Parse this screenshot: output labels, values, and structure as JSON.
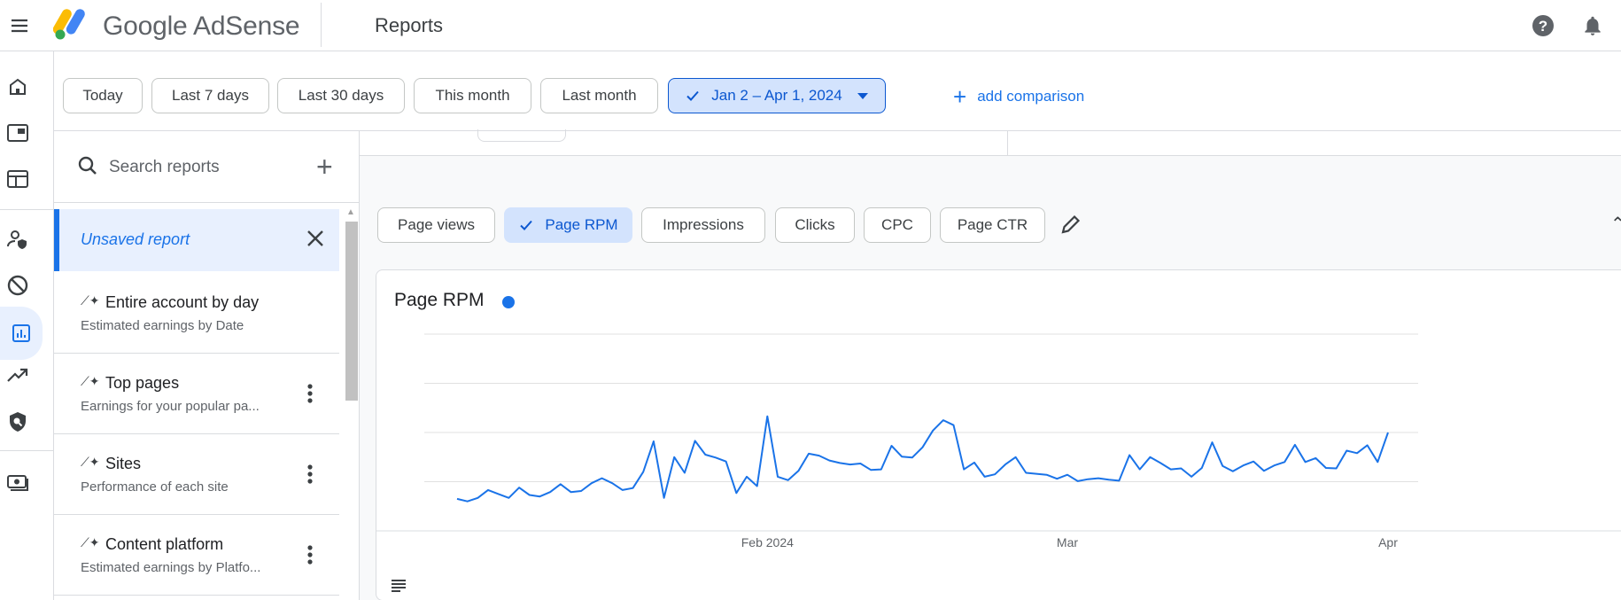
{
  "header": {
    "brand": "Google AdSense",
    "page_title": "Reports"
  },
  "date_chips": [
    {
      "label": "Today"
    },
    {
      "label": "Last 7 days"
    },
    {
      "label": "Last 30 days"
    },
    {
      "label": "This month"
    },
    {
      "label": "Last month"
    },
    {
      "label": "Jan 2 – Apr 1, 2024",
      "selected": true
    }
  ],
  "add_comparison": "add comparison",
  "reports_panel": {
    "search_placeholder": "Search reports",
    "unsaved_label": "Unsaved report",
    "items": [
      {
        "title": "Entire account by day",
        "subtitle": "Estimated earnings by Date"
      },
      {
        "title": "Top pages",
        "subtitle": "Earnings for your popular pa..."
      },
      {
        "title": "Sites",
        "subtitle": "Performance of each site"
      },
      {
        "title": "Content platform",
        "subtitle": "Estimated earnings by Platfo..."
      }
    ]
  },
  "metric_chips": [
    {
      "label": "Page views"
    },
    {
      "label": "Page RPM",
      "selected": true
    },
    {
      "label": "Impressions"
    },
    {
      "label": "Clicks"
    },
    {
      "label": "CPC"
    },
    {
      "label": "Page CTR"
    }
  ],
  "colors": {
    "accent": "#1a73e8",
    "selected_chip_bg": "#d3e3fd",
    "line": "#1a73e8"
  },
  "chart_data": {
    "type": "line",
    "title": "Page RPM",
    "xlabel": "",
    "ylabel": "",
    "x_tick_labels": [
      "Feb 2024",
      "Mar",
      "Apr"
    ],
    "grid": true,
    "gridline_count": 4,
    "ylim": [
      0,
      4
    ],
    "x": [
      "2024-01-02",
      "2024-01-03",
      "2024-01-04",
      "2024-01-05",
      "2024-01-06",
      "2024-01-07",
      "2024-01-08",
      "2024-01-09",
      "2024-01-10",
      "2024-01-11",
      "2024-01-12",
      "2024-01-13",
      "2024-01-14",
      "2024-01-15",
      "2024-01-16",
      "2024-01-17",
      "2024-01-18",
      "2024-01-19",
      "2024-01-20",
      "2024-01-21",
      "2024-01-22",
      "2024-01-23",
      "2024-01-24",
      "2024-01-25",
      "2024-01-26",
      "2024-01-27",
      "2024-01-28",
      "2024-01-29",
      "2024-01-30",
      "2024-01-31",
      "2024-02-01",
      "2024-02-02",
      "2024-02-03",
      "2024-02-04",
      "2024-02-05",
      "2024-02-06",
      "2024-02-07",
      "2024-02-08",
      "2024-02-09",
      "2024-02-10",
      "2024-02-11",
      "2024-02-12",
      "2024-02-13",
      "2024-02-14",
      "2024-02-15",
      "2024-02-16",
      "2024-02-17",
      "2024-02-18",
      "2024-02-19",
      "2024-02-20",
      "2024-02-21",
      "2024-02-22",
      "2024-02-23",
      "2024-02-24",
      "2024-02-25",
      "2024-02-26",
      "2024-02-27",
      "2024-02-28",
      "2024-02-29",
      "2024-03-01",
      "2024-03-02",
      "2024-03-03",
      "2024-03-04",
      "2024-03-05",
      "2024-03-06",
      "2024-03-07",
      "2024-03-08",
      "2024-03-09",
      "2024-03-10",
      "2024-03-11",
      "2024-03-12",
      "2024-03-13",
      "2024-03-14",
      "2024-03-15",
      "2024-03-16",
      "2024-03-17",
      "2024-03-18",
      "2024-03-19",
      "2024-03-20",
      "2024-03-21",
      "2024-03-22",
      "2024-03-23",
      "2024-03-24",
      "2024-03-25",
      "2024-03-26",
      "2024-03-27",
      "2024-03-28",
      "2024-03-29",
      "2024-03-30",
      "2024-03-31",
      "2024-04-01"
    ],
    "series": [
      {
        "values": [
          0.65,
          0.6,
          0.67,
          0.83,
          0.75,
          0.67,
          0.88,
          0.73,
          0.7,
          0.79,
          0.95,
          0.79,
          0.81,
          0.97,
          1.07,
          0.97,
          0.83,
          0.87,
          1.2,
          1.82,
          0.67,
          1.5,
          1.18,
          1.83,
          1.55,
          1.49,
          1.41,
          0.77,
          1.1,
          0.91,
          2.33,
          1.1,
          1.03,
          1.22,
          1.57,
          1.53,
          1.43,
          1.38,
          1.35,
          1.37,
          1.24,
          1.25,
          1.73,
          1.51,
          1.49,
          1.7,
          2.04,
          2.25,
          2.15,
          1.25,
          1.39,
          1.1,
          1.15,
          1.35,
          1.5,
          1.18,
          1.16,
          1.14,
          1.06,
          1.14,
          1.01,
          1.05,
          1.07,
          1.04,
          1.02,
          1.54,
          1.25,
          1.5,
          1.38,
          1.25,
          1.27,
          1.1,
          1.28,
          1.8,
          1.32,
          1.21,
          1.33,
          1.41,
          1.22,
          1.33,
          1.4,
          1.75,
          1.4,
          1.48,
          1.28,
          1.27,
          1.63,
          1.58,
          1.74,
          1.4,
          2.0
        ]
      }
    ]
  }
}
